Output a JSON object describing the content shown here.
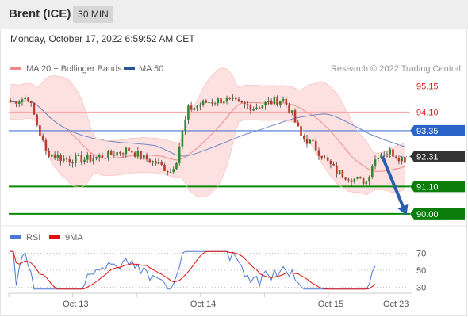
{
  "header": {
    "title": "Brent (ICE)",
    "timeframe": "30 MIN",
    "datetime": "Monday, October 17, 2022 6:59:52 AM CET"
  },
  "legend": {
    "items": [
      {
        "label": "MA 20 + Bollinger Bands",
        "color": "#f08a8a"
      },
      {
        "label": "MA 50",
        "color": "#2b5494"
      }
    ],
    "copyright": "Research © 2022 Trading Central"
  },
  "rsi_legend": {
    "items": [
      {
        "label": "RSI",
        "color": "#4a78d4"
      },
      {
        "label": "9MA",
        "color": "#e01010"
      }
    ]
  },
  "chart_data": [
    {
      "type": "candlestick",
      "title": "Brent (ICE)",
      "ylim": [
        89.55,
        95.55
      ],
      "grid": false,
      "x_ticks": [
        {
          "label": "Oct 13",
          "bar": 22
        },
        {
          "label": "Oct 14",
          "bar": 65
        },
        {
          "label": "Oct 15",
          "bar": 108
        },
        {
          "label": "Oct 23",
          "bar": 130
        }
      ],
      "levels": [
        {
          "value": 95.15,
          "label": "95.15",
          "kind": "resistance"
        },
        {
          "value": 94.1,
          "label": "94.10",
          "kind": "resistance"
        },
        {
          "value": 93.35,
          "label": "93.35",
          "kind": "pivot"
        },
        {
          "value": 92.31,
          "label": "92.31",
          "kind": "last"
        },
        {
          "value": 91.1,
          "label": "91.10",
          "kind": "support"
        },
        {
          "value": 90.0,
          "label": "90.00",
          "kind": "support"
        }
      ],
      "series": [
        {
          "name": "MA 20 + Bollinger Bands",
          "kind": "bollinger"
        },
        {
          "name": "MA 50",
          "kind": "ma50"
        }
      ],
      "forecast_arrow": {
        "from": 92.31,
        "to": 90.0
      }
    },
    {
      "type": "line",
      "title": "RSI",
      "ylim": [
        25,
        75
      ],
      "y_ticks": [
        70,
        50,
        30
      ],
      "series": [
        {
          "name": "RSI"
        },
        {
          "name": "9MA"
        }
      ]
    }
  ]
}
